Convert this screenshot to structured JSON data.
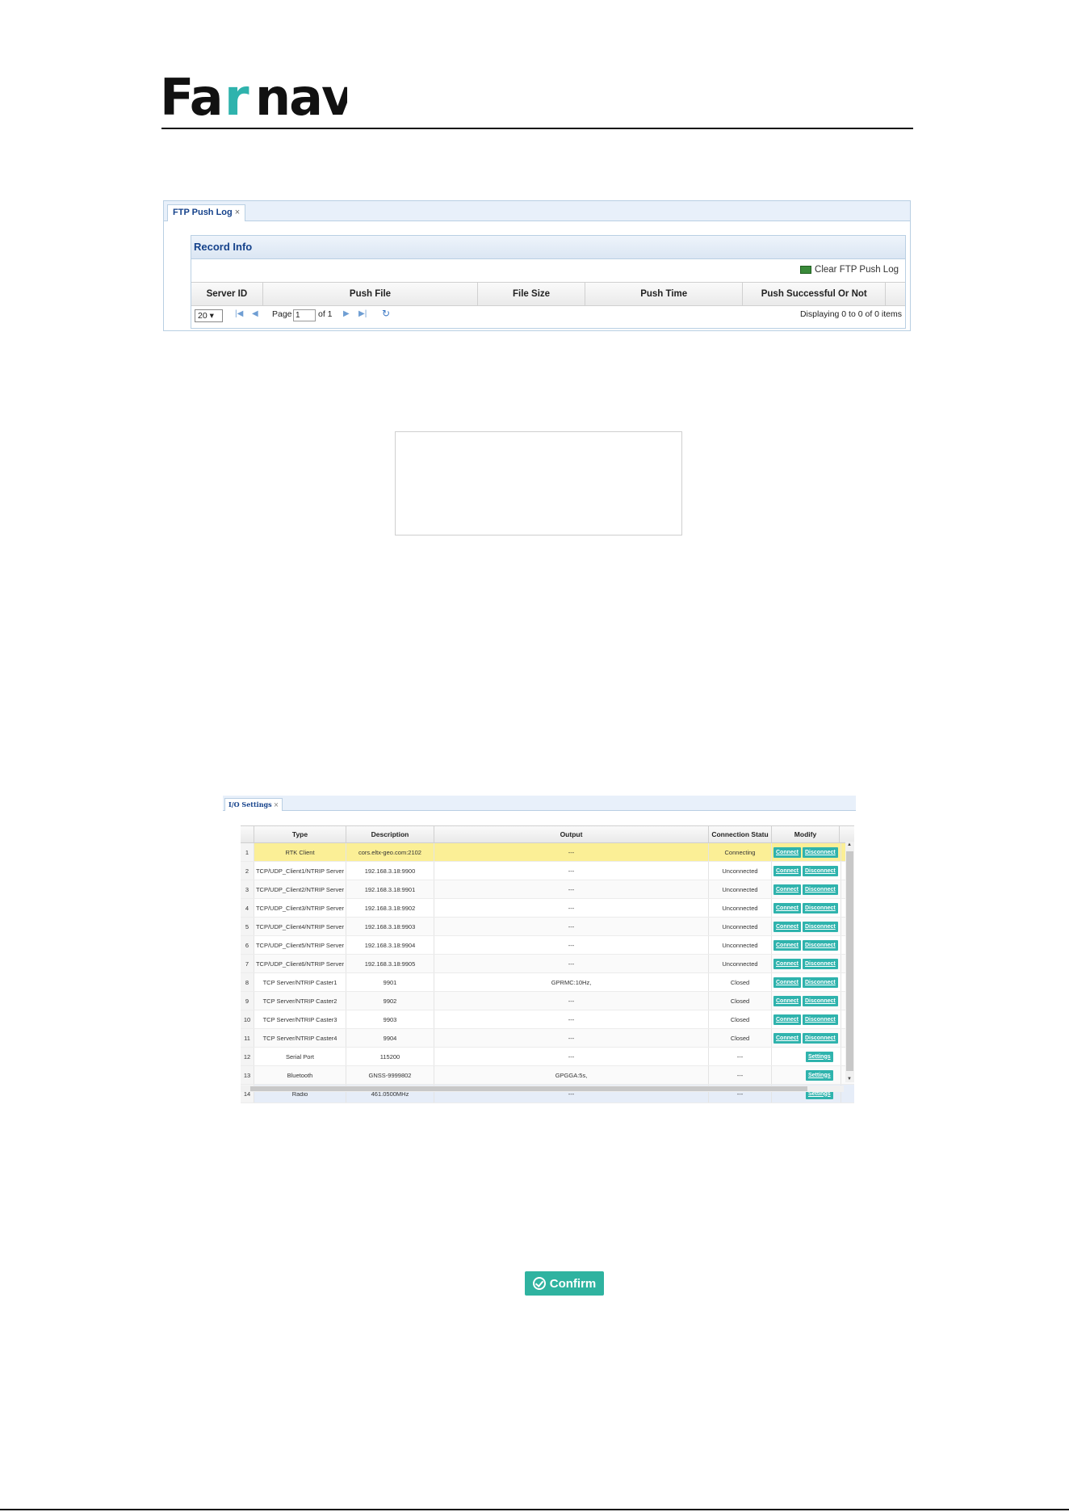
{
  "brand": {
    "logo_text": "Farnav",
    "accent": "#2fb3ad"
  },
  "ftp_panel": {
    "tab_label": "FTP Push Log",
    "tab_close": "×",
    "section_title": "Record Info",
    "clear_label": "Clear FTP Push Log",
    "columns": [
      "Server ID",
      "Push File",
      "File Size",
      "Push Time",
      "Push Successful Or Not"
    ],
    "pager": {
      "page_size": "20 ▾",
      "page_label": "Page",
      "page_value": "1",
      "of_label": "of 1",
      "display_text": "Displaying 0 to 0 of 0 items"
    }
  },
  "io_panel": {
    "tab_label": "I/O Settings",
    "tab_close": "×",
    "columns": [
      "Type",
      "Description",
      "Output",
      "Connection Statu",
      "Modify"
    ],
    "connect_label": "Connect",
    "disconnect_label": "Disconnect",
    "settings_label": "Settings",
    "rows": [
      {
        "num": "1",
        "type": "RTK Client",
        "desc": "cors.eltx-geo.com:2102",
        "output": "---",
        "status": "Connecting",
        "modify": "connect"
      },
      {
        "num": "2",
        "type": "TCP/UDP_Client1/NTRIP Server",
        "desc": "192.168.3.18:9900",
        "output": "---",
        "status": "Unconnected",
        "modify": "connect"
      },
      {
        "num": "3",
        "type": "TCP/UDP_Client2/NTRIP Server",
        "desc": "192.168.3.18:9901",
        "output": "---",
        "status": "Unconnected",
        "modify": "connect"
      },
      {
        "num": "4",
        "type": "TCP/UDP_Client3/NTRIP Server",
        "desc": "192.168.3.18:9902",
        "output": "---",
        "status": "Unconnected",
        "modify": "connect"
      },
      {
        "num": "5",
        "type": "TCP/UDP_Client4/NTRIP Server",
        "desc": "192.168.3.18:9903",
        "output": "---",
        "status": "Unconnected",
        "modify": "connect"
      },
      {
        "num": "6",
        "type": "TCP/UDP_Client5/NTRIP Server",
        "desc": "192.168.3.18:9904",
        "output": "---",
        "status": "Unconnected",
        "modify": "connect"
      },
      {
        "num": "7",
        "type": "TCP/UDP_Client6/NTRIP Server",
        "desc": "192.168.3.18:9905",
        "output": "---",
        "status": "Unconnected",
        "modify": "connect"
      },
      {
        "num": "8",
        "type": "TCP Server/NTRIP Caster1",
        "desc": "9901",
        "output": "GPRMC:10Hz,",
        "status": "Closed",
        "modify": "connect"
      },
      {
        "num": "9",
        "type": "TCP Server/NTRIP Caster2",
        "desc": "9902",
        "output": "---",
        "status": "Closed",
        "modify": "connect"
      },
      {
        "num": "10",
        "type": "TCP Server/NTRIP Caster3",
        "desc": "9903",
        "output": "---",
        "status": "Closed",
        "modify": "connect"
      },
      {
        "num": "11",
        "type": "TCP Server/NTRIP Caster4",
        "desc": "9904",
        "output": "---",
        "status": "Closed",
        "modify": "connect"
      },
      {
        "num": "12",
        "type": "Serial Port",
        "desc": "115200",
        "output": "---",
        "status": "---",
        "modify": "settings"
      },
      {
        "num": "13",
        "type": "Bluetooth",
        "desc": "GNSS-9999802",
        "output": "GPGGA:5s,",
        "status": "---",
        "modify": "settings"
      },
      {
        "num": "14",
        "type": "Radio",
        "desc": "461.0500MHz",
        "output": "---",
        "status": "---",
        "modify": "settings"
      }
    ]
  },
  "confirm_label": "Confirm"
}
